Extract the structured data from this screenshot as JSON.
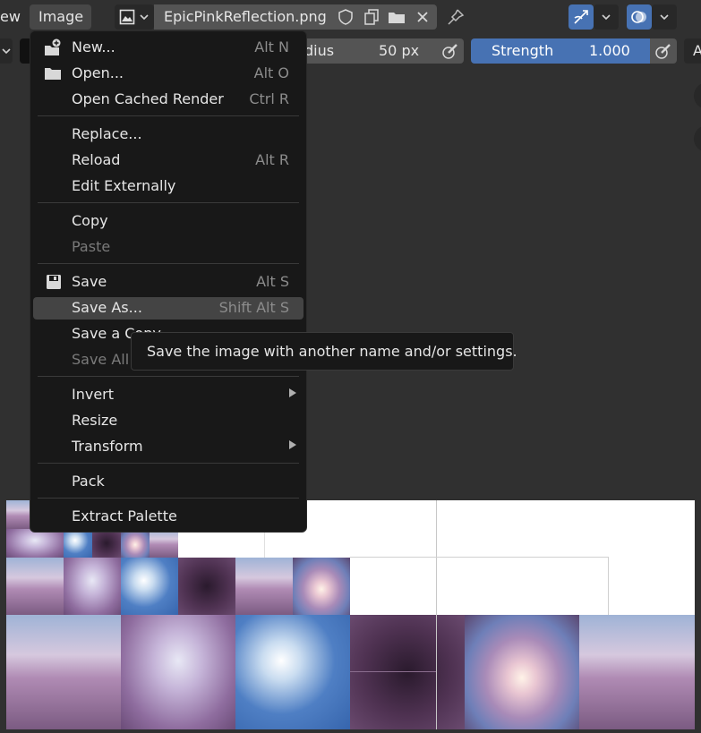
{
  "header": {
    "view_menu_partial": "ew",
    "image_menu": "Image",
    "image_name": "EpicPinkReflection.png"
  },
  "tool_settings": {
    "radius_label_partial": "dius",
    "radius_value": "50 px",
    "strength_label": "Strength",
    "strength_value": "1.000",
    "right_partial": "A"
  },
  "menu": {
    "items": [
      {
        "label": "New...",
        "shortcut": "Alt N"
      },
      {
        "label": "Open...",
        "shortcut": "Alt O"
      },
      {
        "label": "Open Cached Render",
        "shortcut": "Ctrl R"
      },
      {
        "label": "Replace...",
        "shortcut": ""
      },
      {
        "label": "Reload",
        "shortcut": "Alt R"
      },
      {
        "label": "Edit Externally",
        "shortcut": ""
      },
      {
        "label": "Copy",
        "shortcut": ""
      },
      {
        "label": "Paste",
        "shortcut": ""
      },
      {
        "label": "Save",
        "shortcut": "Alt S"
      },
      {
        "label": "Save As...",
        "shortcut": "Shift Alt S"
      },
      {
        "label": "Save a Copy",
        "shortcut": ""
      },
      {
        "label": "Save All",
        "shortcut": ""
      },
      {
        "label": "Invert",
        "shortcut": ""
      },
      {
        "label": "Resize",
        "shortcut": ""
      },
      {
        "label": "Transform",
        "shortcut": ""
      },
      {
        "label": "Pack",
        "shortcut": ""
      },
      {
        "label": "Extract Palette",
        "shortcut": ""
      }
    ]
  },
  "tooltip": {
    "text": "Save the image with another name and/or settings."
  },
  "colors": {
    "accent_blue": "#4772b3",
    "menu_bg": "#181818",
    "highlight": "#444444"
  }
}
